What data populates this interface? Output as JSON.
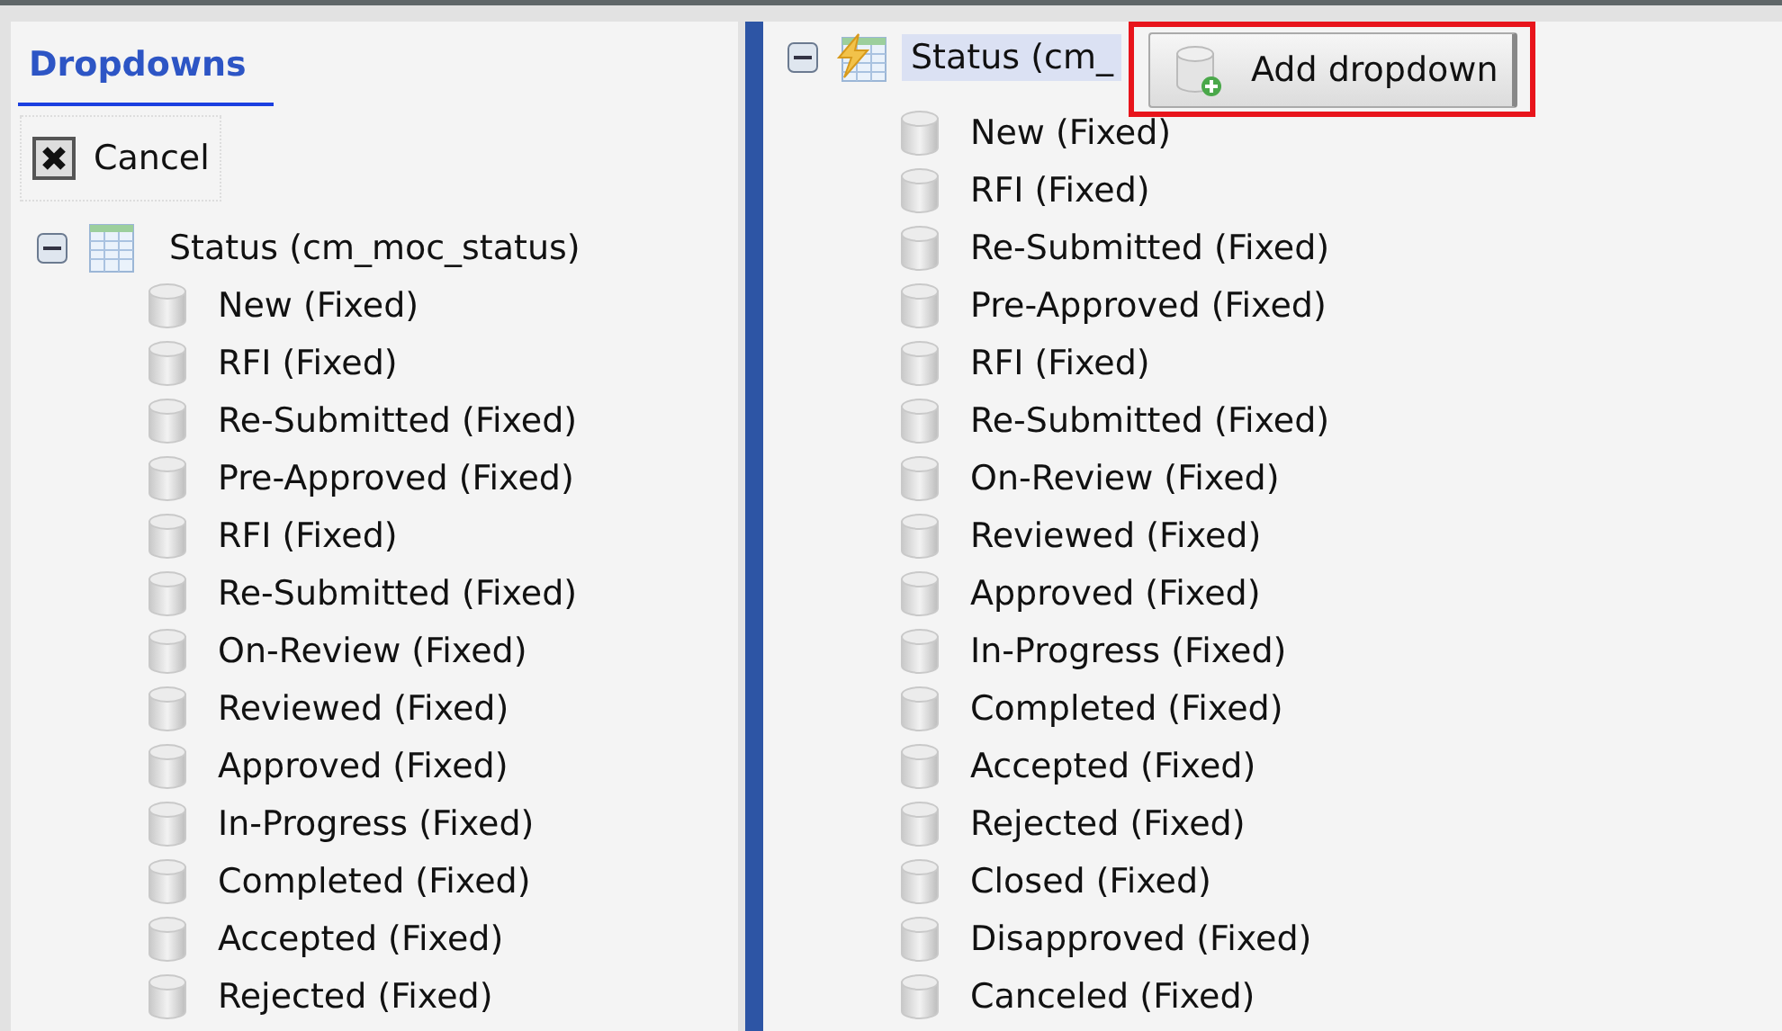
{
  "left_panel": {
    "title": "Dropdowns",
    "cancel_button": "Cancel",
    "tree": {
      "label": "Status (cm_moc_status)",
      "kind": "table",
      "expanded": true,
      "selected": false,
      "children": [
        {
          "label": "New (Fixed)"
        },
        {
          "label": "RFI (Fixed)"
        },
        {
          "label": "Re-Submitted (Fixed)"
        },
        {
          "label": "Pre-Approved (Fixed)"
        },
        {
          "label": "RFI (Fixed)"
        },
        {
          "label": "Re-Submitted (Fixed)"
        },
        {
          "label": "On-Review (Fixed)"
        },
        {
          "label": "Reviewed (Fixed)"
        },
        {
          "label": "Approved (Fixed)"
        },
        {
          "label": "In-Progress (Fixed)"
        },
        {
          "label": "Completed (Fixed)"
        },
        {
          "label": "Accepted (Fixed)"
        },
        {
          "label": "Rejected (Fixed)"
        }
      ]
    }
  },
  "right_panel": {
    "add_button": "Add dropdown",
    "add_button_highlighted": true,
    "tree": {
      "label": "Status (cm_",
      "kind": "lightning-table",
      "expanded": true,
      "selected": true,
      "children": [
        {
          "label": "New (Fixed)"
        },
        {
          "label": "RFI (Fixed)"
        },
        {
          "label": "Re-Submitted (Fixed)"
        },
        {
          "label": "Pre-Approved (Fixed)"
        },
        {
          "label": "RFI (Fixed)"
        },
        {
          "label": "Re-Submitted (Fixed)"
        },
        {
          "label": "On-Review (Fixed)"
        },
        {
          "label": "Reviewed (Fixed)"
        },
        {
          "label": "Approved (Fixed)"
        },
        {
          "label": "In-Progress (Fixed)"
        },
        {
          "label": "Completed (Fixed)"
        },
        {
          "label": "Accepted (Fixed)"
        },
        {
          "label": "Rejected (Fixed)"
        },
        {
          "label": "Closed (Fixed)"
        },
        {
          "label": "Disapproved (Fixed)"
        },
        {
          "label": "Canceled (Fixed)"
        }
      ]
    }
  }
}
